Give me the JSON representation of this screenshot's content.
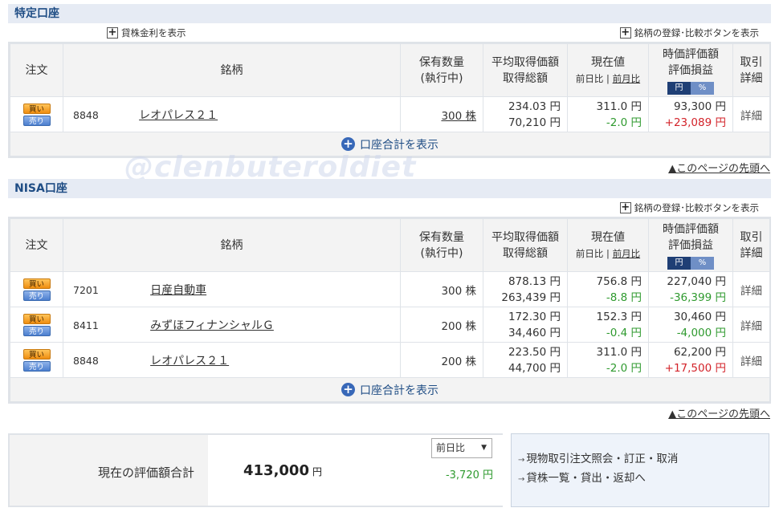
{
  "tokutei": {
    "title": "特定口座",
    "lending_link": "貸株金利を表示",
    "register_link": "銘柄の登録･比較ボタンを表示",
    "rows": [
      {
        "code": "8848",
        "name": "レオパレス２１",
        "qty": "300 株",
        "avg_price": "234.03 円",
        "total_cost": "70,210 円",
        "price": "311.0 円",
        "change": "-2.0 円",
        "value": "93,300 円",
        "pl": "+23,089 円"
      }
    ],
    "total_link": "口座合計を表示"
  },
  "nisa": {
    "title": "NISA口座",
    "register_link": "銘柄の登録･比較ボタンを表示",
    "rows": [
      {
        "code": "7201",
        "name": "日産自動車",
        "qty": "300 株",
        "avg_price": "878.13 円",
        "total_cost": "263,439 円",
        "price": "756.8 円",
        "change": "-8.8 円",
        "value": "227,040 円",
        "pl": "-36,399 円"
      },
      {
        "code": "8411",
        "name": "みずほフィナンシャルＧ",
        "qty": "200 株",
        "avg_price": "172.30 円",
        "total_cost": "34,460 円",
        "price": "152.3 円",
        "change": "-0.4 円",
        "value": "30,460 円",
        "pl": "-4,000 円"
      },
      {
        "code": "8848",
        "name": "レオパレス２１",
        "qty": "200 株",
        "avg_price": "223.50 円",
        "total_cost": "44,700 円",
        "price": "311.0 円",
        "change": "-2.0 円",
        "value": "62,200 円",
        "pl": "+17,500 円"
      }
    ],
    "total_link": "口座合計を表示"
  },
  "headers": {
    "order": "注文",
    "stock": "銘柄",
    "qty1": "保有数量",
    "qty2": "(執行中)",
    "avg1": "平均取得価額",
    "avg2": "取得総額",
    "price1": "現在値",
    "price_day": "前日比",
    "price_sep": " | ",
    "price_month": "前月比",
    "val1": "時価評価額",
    "val2": "評価損益",
    "toggle_yen": "円",
    "toggle_pct": "%",
    "detail1": "取引",
    "detail2": "詳細"
  },
  "buttons": {
    "buy": "買い",
    "sell": "売り",
    "detail": "詳細"
  },
  "page_top": "▲このページの先頭へ",
  "watermark": "@clenbuteroldiet",
  "summary": {
    "label": "現在の評価額合計",
    "value": "413,000",
    "unit": "円",
    "select": "前日比",
    "change": "-3,720 円"
  },
  "links": {
    "order_inquiry": "現物取引注文照会・訂正・取消",
    "lending_list": "貸株一覧・貸出・返却へ"
  },
  "colors": {
    "positive": "#d3232a",
    "negative": "#2f9a2f",
    "section_title": "#1f4d85"
  }
}
